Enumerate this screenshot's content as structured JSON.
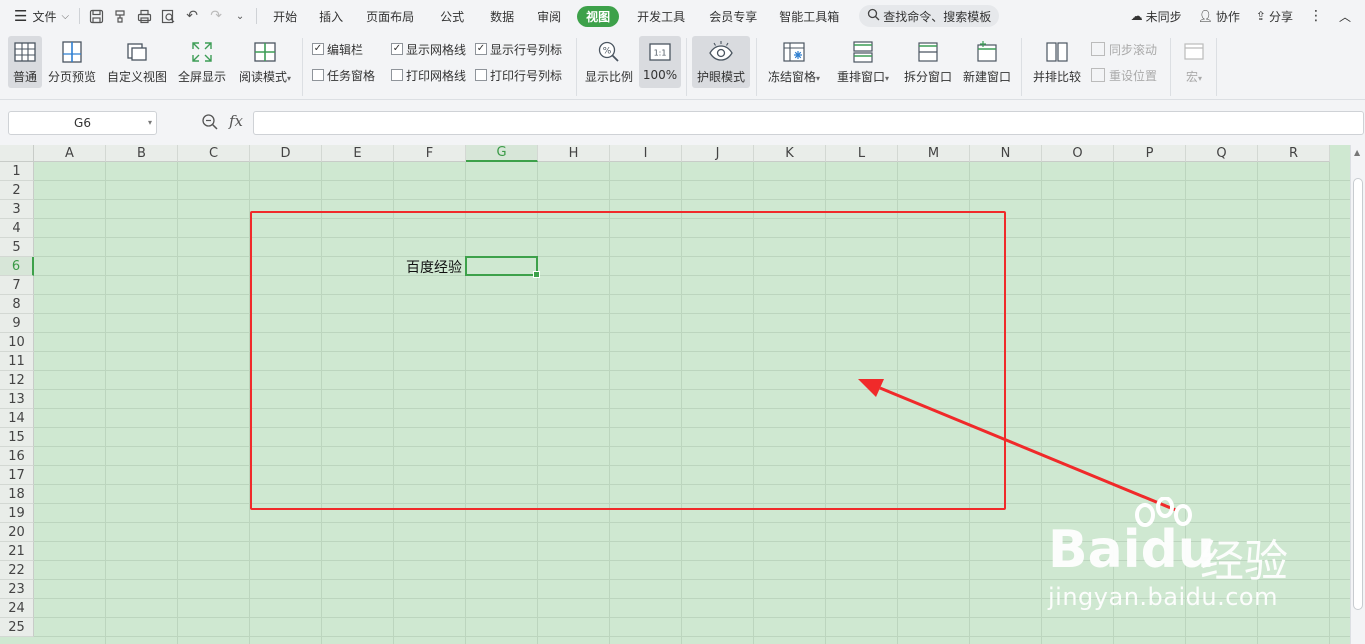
{
  "menubar": {
    "file": "文件",
    "tabs": [
      {
        "label": "开始",
        "active": false
      },
      {
        "label": "插入",
        "active": false
      },
      {
        "label": "页面布局",
        "active": false
      },
      {
        "label": "公式",
        "active": false
      },
      {
        "label": "数据",
        "active": false
      },
      {
        "label": "审阅",
        "active": false
      },
      {
        "label": "视图",
        "active": true
      },
      {
        "label": "开发工具",
        "active": false
      },
      {
        "label": "会员专享",
        "active": false
      },
      {
        "label": "智能工具箱",
        "active": false
      }
    ],
    "search": "查找命令、搜索模板",
    "sync": "未同步",
    "collab": "协作",
    "share": "分享"
  },
  "ribbon": {
    "normal": "普通",
    "page_preview": "分页预览",
    "custom_view": "自定义视图",
    "fullscreen": "全屏显示",
    "read_mode": "阅读模式",
    "edit_bar": "编辑栏",
    "task_pane": "任务窗格",
    "show_grid": "显示网格线",
    "print_grid": "打印网格线",
    "show_headers": "显示行号列标",
    "print_headers": "打印行号列标",
    "zoom": "显示比例",
    "zoom100": "100%",
    "eye_mode": "护眼模式",
    "freeze": "冻结窗格",
    "arrange": "重排窗口",
    "split": "拆分窗口",
    "new_window": "新建窗口",
    "side_by_side": "并排比较",
    "sync_scroll": "同步滚动",
    "reset_pos": "重设位置",
    "macro": "宏"
  },
  "formula": {
    "namebox": "G6",
    "fx": "fx",
    "value": ""
  },
  "sheet": {
    "columns": [
      "A",
      "B",
      "C",
      "D",
      "E",
      "F",
      "G",
      "H",
      "I",
      "J",
      "K",
      "L",
      "M",
      "N",
      "O",
      "P",
      "Q",
      "R"
    ],
    "rows": [
      "1",
      "2",
      "3",
      "4",
      "5",
      "6",
      "7",
      "8",
      "9",
      "10",
      "11",
      "12",
      "13",
      "14",
      "15",
      "16",
      "17",
      "18",
      "19",
      "20",
      "21",
      "22",
      "23",
      "24",
      "25"
    ],
    "cell_F6": "百度经验",
    "selected_col": "G",
    "selected_row": "6"
  },
  "watermark": {
    "brand": "Bai",
    "brand2": "du",
    "cn": "经验",
    "url": "jingyan.baidu.com"
  },
  "colors": {
    "accent": "#3da14a",
    "eye_mode_bg": "#cfe8d1",
    "annotation": "#f02a2a"
  }
}
